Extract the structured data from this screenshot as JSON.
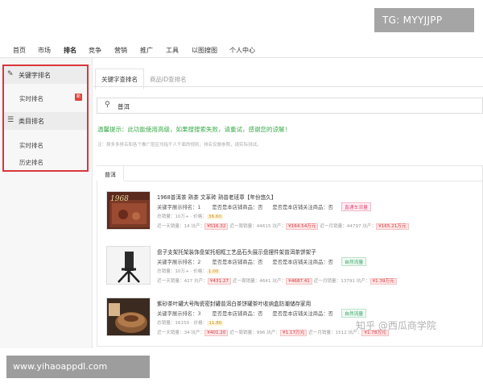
{
  "top_nav": [
    "首页",
    "市场",
    "排名",
    "竞争",
    "营销",
    "推广",
    "工具",
    "以图搜图",
    "个人中心"
  ],
  "sidebar": {
    "keyword_group": "关键字排名",
    "keyword_items": [
      "实时排名"
    ],
    "new_badge": "新",
    "category_group": "类目排名",
    "category_items": [
      "实时排名",
      "历史排名"
    ]
  },
  "subtabs": [
    "关键字查排名",
    "商品ID查排名"
  ],
  "search": {
    "value": "普洱"
  },
  "tip": "温馨提示：此功能使用高级，如果搜搜索失败，请重试，感谢您的谅解！",
  "note": "注：择多多排名和各个推广层区均指千人千面的规则，排名仅做参照，请实际测试。",
  "result_tab": "普洱",
  "results": [
    {
      "title": "1968普洱茶 熟茶 文革砖 熟普老班章【年份悠久】",
      "rank_label": "关键字展示排名：",
      "rank": "1",
      "store_label": "是否是本店铺商品：否",
      "follow_label": "是否是本店铺关注商品：否",
      "tag": "直通车流量",
      "total_sales_label": "总销量：10万+ ·",
      "price_label": "价格：",
      "price": "36.60",
      "day_sales_label": "近一天销量：14",
      "day_pit_label": "坑产：",
      "day_pit": "¥516.32",
      "month_sales_label": "近一周销量：44615",
      "month_pit_label": "坑产：",
      "month_pit": "¥164.54万元",
      "year_sales_label": "近一月销量：44797",
      "year_pit_label": "坑产：",
      "year_pit": "¥165.21万元"
    },
    {
      "title": "盘子支架托架装饰盘架托相框工艺品石头展示盘摆件架普洱茶饼架子",
      "rank_label": "关键字展示排名：",
      "rank": "2",
      "store_label": "是否是本店铺商品：否",
      "follow_label": "是否是本店铺关注商品：否",
      "tag": "自然流量",
      "total_sales_label": "总销量：10万+ ·",
      "price_label": "价格：",
      "price": "1.00",
      "day_sales_label": "近一天销量：427",
      "day_pit_label": "坑产：",
      "day_pit": "¥431.27",
      "month_sales_label": "近一周销量：4641",
      "month_pit_label": "坑产：",
      "month_pit": "¥4687.41",
      "year_sales_label": "近一月销量：13791",
      "year_pit_label": "坑产：",
      "year_pit": "¥1.39万元"
    },
    {
      "title": "紫砂茶叶罐大号陶瓷密封罐普洱白茶饼罐茶叶收纳盒防潮储存家用",
      "rank_label": "关键字展示排名：",
      "rank": "3",
      "store_label": "是否是本店铺商品：否",
      "follow_label": "是否是本店铺关注商品：否",
      "tag": "自然流量",
      "total_sales_label": "总销量：16150 ·",
      "price_label": "价格：",
      "price": "11.80",
      "day_sales_label": "近一天销量：34",
      "day_pit_label": "坑产：",
      "day_pit": "¥401.20",
      "month_sales_label": "近一周销量：996",
      "month_pit_label": "坑产：",
      "month_pit": "¥1.17万元",
      "year_sales_label": "近一月销量：1512",
      "year_pit_label": "坑产：",
      "year_pit": "¥1.78万元"
    }
  ],
  "watermarks": {
    "tg": "TG: MYYJJPP",
    "url": "www.yihaoappdl.com",
    "zhihu": "知乎 @西瓜商学院"
  },
  "colors": {
    "accent": "#d9363e",
    "tip_green": "#3aa94a",
    "sidebar_bg": "#f7f7f7"
  }
}
